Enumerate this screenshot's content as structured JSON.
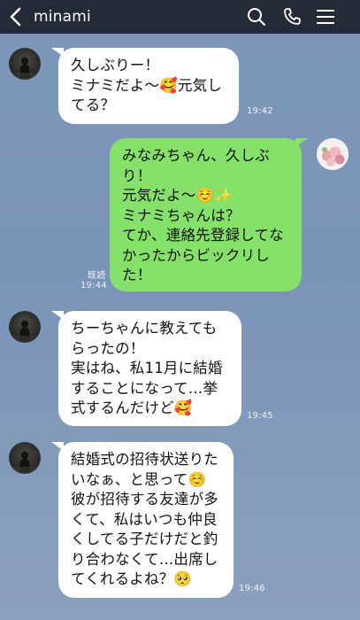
{
  "header": {
    "title": "minami"
  },
  "colors": {
    "header_bg": "#232a38",
    "chat_bg": "#7b95b8",
    "incoming_bubble": "#ffffff",
    "outgoing_bubble": "#85e169"
  },
  "icons": {
    "back": "chevron-left-icon",
    "search": "search-icon",
    "call": "phone-icon",
    "menu": "hamburger-menu-icon"
  },
  "messages": [
    {
      "direction": "incoming",
      "text": "久しぶりー！\nミナミだよ〜🥰元気し\nてる？",
      "time": "19:42"
    },
    {
      "direction": "outgoing",
      "text": "みなみちゃん、久しぶ\nり！\n元気だよ〜☺️✨\nミナミちゃんは？\nてか、連絡先登録してな\nかったからビックリし\nた！",
      "read": "既読",
      "time": "19:44"
    },
    {
      "direction": "incoming",
      "text": "ちーちゃんに教えても\nらったの！\n実はね、私11月に結婚\nすることになって…挙\n式するんだけど🥰",
      "time": "19:45"
    },
    {
      "direction": "incoming",
      "text": "結婚式の招待状送りた\nいなぁ、と思って☺️\n彼が招待する友達が多\nくて、私はいつも仲良\nくしてる子だけだと釣\nり合わなくて…出席し\nてくれるよね？🥺",
      "time": "19:46"
    }
  ]
}
